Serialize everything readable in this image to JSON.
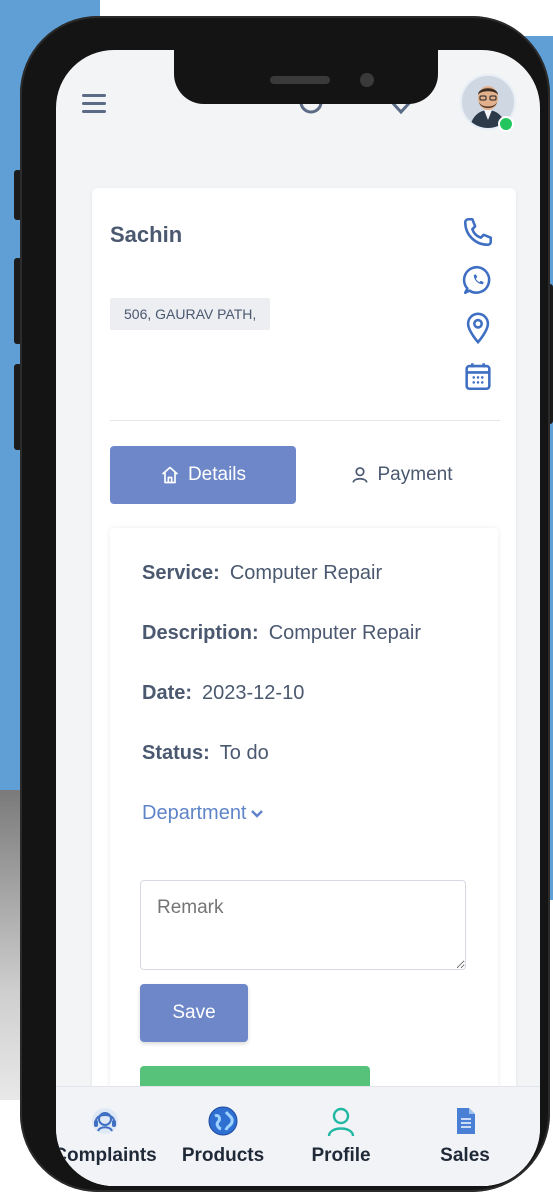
{
  "customer": {
    "name": "Sachin",
    "address": "506, GAURAV PATH,"
  },
  "tabs": {
    "details": "Details",
    "payment": "Payment"
  },
  "details": {
    "service_label": "Service:",
    "service_value": "Computer Repair",
    "description_label": "Description:",
    "description_value": "Computer Repair",
    "date_label": "Date:",
    "date_value": "2023-12-10",
    "status_label": "Status:",
    "status_value": "To do",
    "department_label": "Department"
  },
  "remark": {
    "placeholder": "Remark"
  },
  "save_label": "Save",
  "bottom_nav": [
    {
      "label": "Complaints",
      "icon": "headset-icon"
    },
    {
      "label": "Products",
      "icon": "globe-icon"
    },
    {
      "label": "Profile",
      "icon": "user-icon"
    },
    {
      "label": "Sales",
      "icon": "document-icon"
    }
  ],
  "colors": {
    "primary": "#6d87c9",
    "link": "#5f84c7",
    "icon": "#3f6fc2",
    "online": "#22c55e",
    "success": "#56c27a",
    "background": "#5f9fd6"
  }
}
